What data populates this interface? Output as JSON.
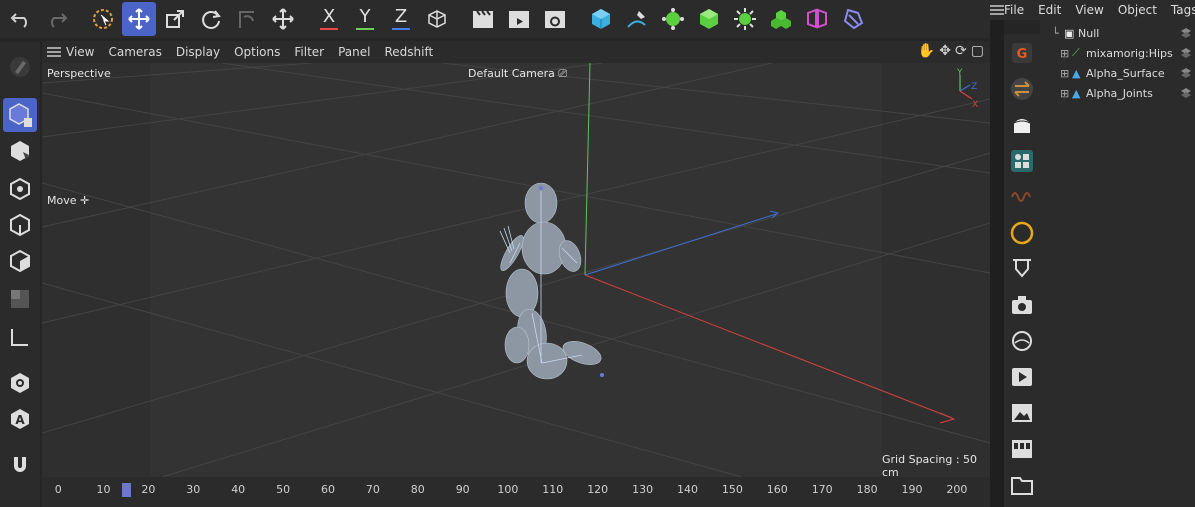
{
  "toolbar": {
    "undo": "undo-icon",
    "redo": "redo-icon",
    "axes": [
      {
        "label": "X",
        "color": "#e84a4a"
      },
      {
        "label": "Y",
        "color": "#6ccf5a"
      },
      {
        "label": "Z",
        "color": "#4a7ee8"
      }
    ]
  },
  "viewport_menu": [
    "View",
    "Cameras",
    "Display",
    "Options",
    "Filter",
    "Panel",
    "Redshift"
  ],
  "viewport": {
    "projection": "Perspective",
    "camera": "Default Camera",
    "tool_label": "Move",
    "grid_spacing": "Grid Spacing : 50 cm",
    "axis_gizmo": {
      "y": "Y",
      "z": "Z",
      "x": "X"
    }
  },
  "timeline": {
    "ticks": [
      "0",
      "10",
      "20",
      "30",
      "40",
      "50",
      "60",
      "70",
      "80",
      "90",
      "100",
      "110",
      "120",
      "130",
      "140",
      "150",
      "160",
      "170",
      "180",
      "190",
      "200"
    ],
    "current_frame": "15"
  },
  "object_manager": {
    "menu": [
      "File",
      "Edit",
      "View",
      "Object",
      "Tags"
    ],
    "items": [
      {
        "name": "Null",
        "indent": 0
      },
      {
        "name": "mixamorig:Hips",
        "indent": 1
      },
      {
        "name": "Alpha_Surface",
        "indent": 1
      },
      {
        "name": "Alpha_Joints",
        "indent": 1
      }
    ]
  },
  "colors": {
    "accent": "#4a64c8",
    "panel": "#2b2b2b",
    "viewport": "#2f2f2f",
    "y_axis": "#5cc45c",
    "z_axis": "#3f6fd8",
    "x_axis": "#d84040"
  }
}
